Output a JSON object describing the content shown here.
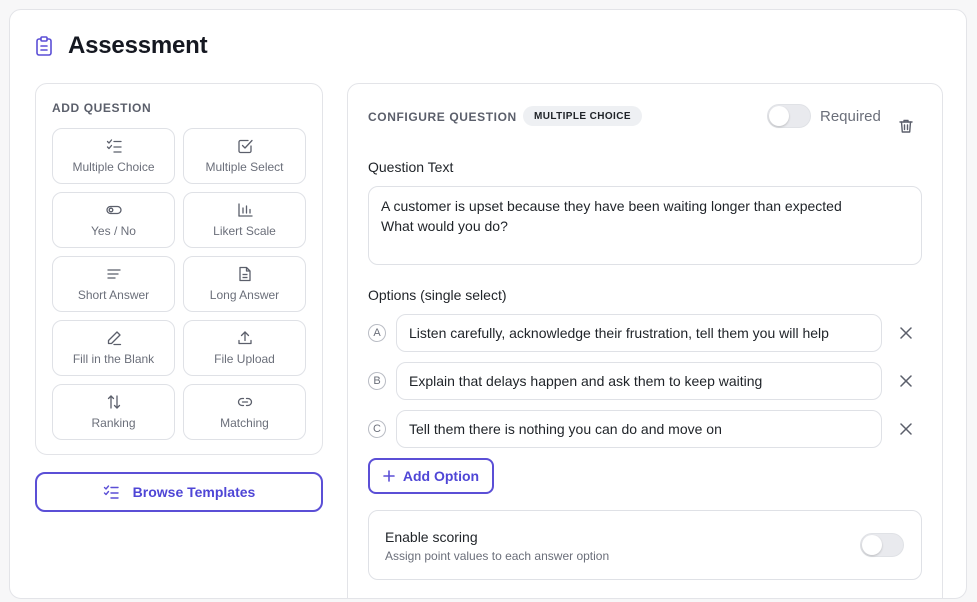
{
  "header": {
    "title": "Assessment",
    "icon": "clipboard-icon"
  },
  "add_question": {
    "label": "ADD QUESTION",
    "types": [
      {
        "label": "Multiple Choice",
        "icon": "list-check-icon"
      },
      {
        "label": "Multiple Select",
        "icon": "checkbox-icon"
      },
      {
        "label": "Yes / No",
        "icon": "toggle-icon"
      },
      {
        "label": "Likert Scale",
        "icon": "bar-chart-icon"
      },
      {
        "label": "Short Answer",
        "icon": "short-text-icon"
      },
      {
        "label": "Long Answer",
        "icon": "document-icon"
      },
      {
        "label": "Fill in the Blank",
        "icon": "pencil-icon"
      },
      {
        "label": "File Upload",
        "icon": "upload-icon"
      },
      {
        "label": "Ranking",
        "icon": "sort-arrows-icon"
      },
      {
        "label": "Matching",
        "icon": "link-icon"
      }
    ]
  },
  "browse_templates": {
    "label": "Browse Templates",
    "icon": "list-check-icon"
  },
  "configure": {
    "label": "CONFIGURE QUESTION",
    "type_badge": "MULTIPLE CHOICE",
    "required_label": "Required",
    "required": false,
    "question_text_label": "Question Text",
    "question_text": "A customer is upset because they have been waiting longer than expected\nWhat would you do?",
    "options_label": "Options (single select)",
    "options": [
      {
        "letter": "A",
        "text": "Listen carefully, acknowledge their frustration, tell them you will help"
      },
      {
        "letter": "B",
        "text": "Explain that delays happen and ask them to keep waiting"
      },
      {
        "letter": "C",
        "text": "Tell them there is nothing you can do and move on"
      }
    ],
    "add_option_label": "Add Option",
    "scoring": {
      "title": "Enable scoring",
      "subtitle": "Assign point values to each answer option",
      "enabled": false
    }
  },
  "colors": {
    "accent": "#5b4fd6",
    "border": "#dfe1e6",
    "muted": "#6b6f7a"
  }
}
